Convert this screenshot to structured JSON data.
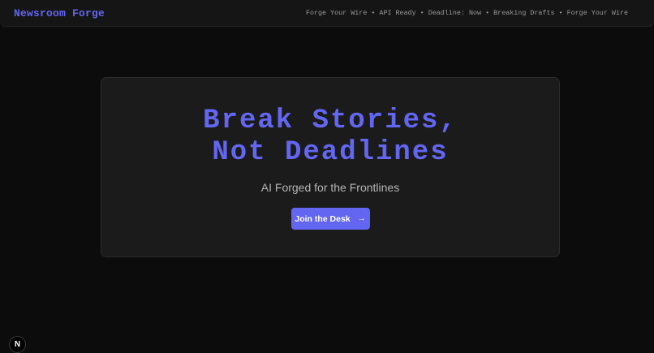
{
  "header": {
    "brand": "Newsroom Forge",
    "ticker": "Forge Your Wire • API Ready • Deadline: Now • Breaking Drafts • Forge Your Wire"
  },
  "hero": {
    "headline_line1": "Break Stories,",
    "headline_line2": "Not Deadlines",
    "tagline": "AI Forged for the Frontlines",
    "cta_label": "Join the Desk",
    "cta_icon": "arrow-right-icon"
  },
  "badge": {
    "letter": "N",
    "icon": "next-logo-icon"
  },
  "colors": {
    "accent": "#6366f1",
    "background": "#0c0c0c",
    "card": "#1b1b1b"
  }
}
